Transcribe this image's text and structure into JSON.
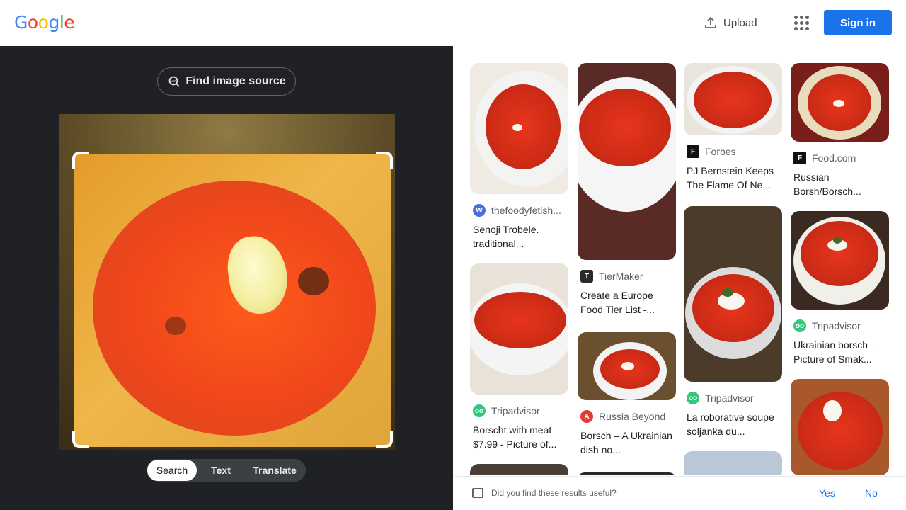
{
  "header": {
    "logo_letters": [
      {
        "ch": "G",
        "color": "#4285F4"
      },
      {
        "ch": "o",
        "color": "#EA4335"
      },
      {
        "ch": "o",
        "color": "#FBBC05"
      },
      {
        "ch": "g",
        "color": "#4285F4"
      },
      {
        "ch": "l",
        "color": "#34A853"
      },
      {
        "ch": "e",
        "color": "#EA4335"
      }
    ],
    "upload_label": "Upload",
    "signin_label": "Sign in"
  },
  "left": {
    "find_source_label": "Find image source",
    "modes": [
      "Search",
      "Text",
      "Translate"
    ],
    "active_mode": "Search"
  },
  "results": [
    {
      "source": "thefoodyfetish...",
      "favicon": "W",
      "favicon_color": "#4a6fd6",
      "title": "Senoji Trobele. traditional...",
      "bg": "#efeae2",
      "bowl": "#f2f0ec",
      "soup": "#d93a1a"
    },
    {
      "source": "Tripadvisor",
      "favicon": "oo",
      "favicon_color": "#34c77b",
      "title": "Borscht with meat $7.99 - Picture of...",
      "bg": "#e9e2d8",
      "bowl": "#f4f4f4",
      "soup": "#d63d1e"
    },
    {
      "source": "TierMaker",
      "favicon": "T",
      "favicon_color": "#2a2a2a",
      "title": "Create a Europe Food Tier List -...",
      "bg": "#5a2a26",
      "bowl": "#f5f5f5",
      "soup": "#cc2f15"
    },
    {
      "source": "Russia Beyond",
      "favicon": "A",
      "favicon_color": "#e53935",
      "title": "Borsch – A Ukrainian dish no...",
      "bg": "#6b5030",
      "bowl": "#f3f3f3",
      "soup": "#e0401e"
    },
    {
      "source": "Forbes",
      "favicon": "F",
      "favicon_color": "#111111",
      "title": "PJ Bernstein Keeps The Flame Of Ne...",
      "bg": "#e9e4dc",
      "bowl": "#f3f3f3",
      "soup": "#e23d22"
    },
    {
      "source": "Tripadvisor",
      "favicon": "oo",
      "favicon_color": "#34c77b",
      "title": "La roborative soupe soljanka du...",
      "bg": "#4b3b2a",
      "bowl": "#e7e7e7",
      "soup": "#b8281a"
    },
    {
      "source": "Food.com",
      "favicon": "F",
      "favicon_color": "#111111",
      "title": "Russian Borsh/Borsch...",
      "bg": "#7a1e1a",
      "bowl": "#e8dcbc",
      "soup": "#d8261c"
    },
    {
      "source": "Tripadvisor",
      "favicon": "oo",
      "favicon_color": "#34c77b",
      "title": "Ukrainian borsch - Picture of Smak...",
      "bg": "#3a2a22",
      "bowl": "#f1efea",
      "soup": "#d3281a"
    }
  ],
  "feedback": {
    "question": "Did you find these results useful?",
    "yes": "Yes",
    "no": "No"
  }
}
